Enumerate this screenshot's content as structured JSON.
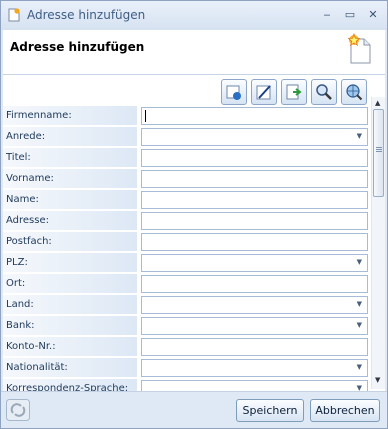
{
  "window": {
    "title": "Adresse hinzufügen",
    "minimize_glyph": "‒",
    "maximize_glyph": "▭",
    "close_glyph": "✕"
  },
  "header": {
    "title": "Adresse hinzufügen",
    "icon": "new-document-icon"
  },
  "toolbar": {
    "buttons": [
      {
        "icon": "import-card-icon"
      },
      {
        "icon": "edit-form-icon"
      },
      {
        "icon": "export-arrow-icon"
      },
      {
        "icon": "search-magnifier-icon"
      },
      {
        "icon": "web-search-icon"
      }
    ]
  },
  "form": {
    "fields": [
      {
        "label": "Firmenname:",
        "value": "",
        "type": "text",
        "focused": true
      },
      {
        "label": "Anrede:",
        "value": "",
        "type": "dropdown"
      },
      {
        "label": "Titel:",
        "value": "",
        "type": "text"
      },
      {
        "label": "Vorname:",
        "value": "",
        "type": "text"
      },
      {
        "label": "Name:",
        "value": "",
        "type": "text"
      },
      {
        "label": "Adresse:",
        "value": "",
        "type": "text"
      },
      {
        "label": "Postfach:",
        "value": "",
        "type": "text"
      },
      {
        "label": "PLZ:",
        "value": "",
        "type": "dropdown"
      },
      {
        "label": "Ort:",
        "value": "",
        "type": "text"
      },
      {
        "label": "Land:",
        "value": "",
        "type": "dropdown"
      },
      {
        "label": "Bank:",
        "value": "",
        "type": "dropdown"
      },
      {
        "label": "Konto-Nr.:",
        "value": "",
        "type": "text"
      },
      {
        "label": "Nationalität:",
        "value": "",
        "type": "dropdown"
      },
      {
        "label": "Korrespondenz-Sprache:",
        "value": "",
        "type": "dropdown"
      }
    ]
  },
  "footer": {
    "save_label": "Speichern",
    "cancel_label": "Abbrechen"
  },
  "colors": {
    "accent": "#dfe9f5",
    "border": "#8ea3c2"
  }
}
